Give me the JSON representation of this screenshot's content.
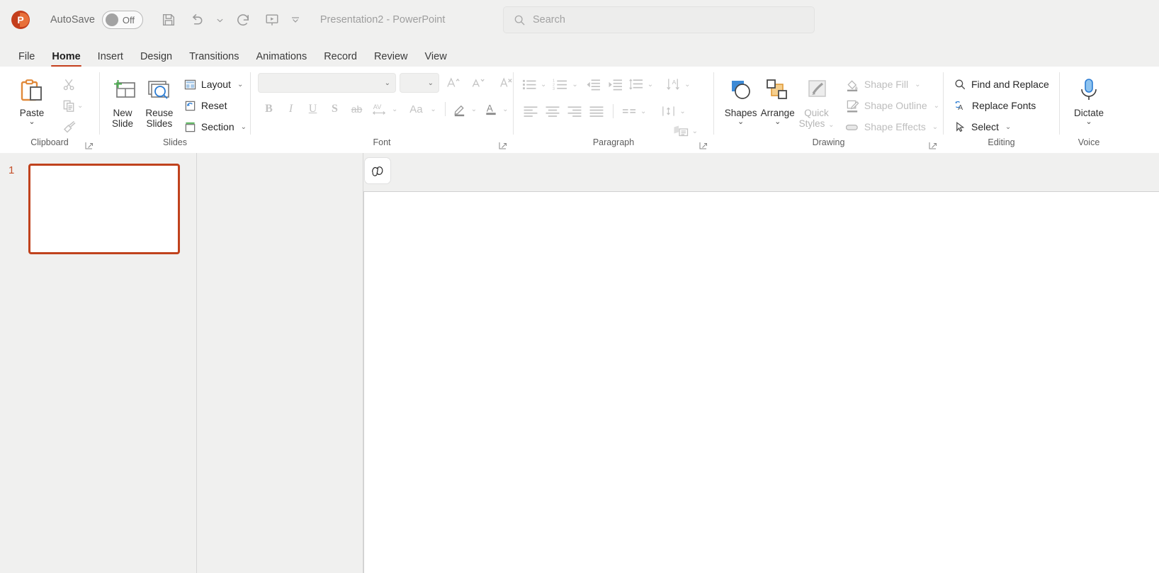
{
  "titlebar": {
    "logo_name": "powerpoint-logo",
    "logo_letter": "P",
    "autosave_label": "AutoSave",
    "autosave_state": "Off",
    "document_title": "Presentation2  -  PowerPoint",
    "quick_access": [
      {
        "name": "save-button",
        "icon": "save-icon"
      },
      {
        "name": "undo-button",
        "icon": "undo-icon"
      },
      {
        "name": "undo-dropdown",
        "icon": "chevron-down-icon"
      },
      {
        "name": "redo-button",
        "icon": "redo-icon"
      },
      {
        "name": "start-presentation-button",
        "icon": "presentation-icon"
      },
      {
        "name": "customize-quick-access-toolbar",
        "icon": "chevron-down-small-icon"
      }
    ]
  },
  "search": {
    "placeholder": "Search",
    "value": "",
    "icon": "search-icon"
  },
  "tabs": [
    {
      "label": "File",
      "active": false
    },
    {
      "label": "Home",
      "active": true
    },
    {
      "label": "Insert",
      "active": false
    },
    {
      "label": "Design",
      "active": false
    },
    {
      "label": "Transitions",
      "active": false
    },
    {
      "label": "Animations",
      "active": false
    },
    {
      "label": "Record",
      "active": false
    },
    {
      "label": "Review",
      "active": false
    },
    {
      "label": "View",
      "active": false
    }
  ],
  "ribbon": {
    "clipboard": {
      "group_label": "Clipboard",
      "paste_label": "Paste",
      "cut_label": "Cut",
      "copy_label": "Copy",
      "format_painter_label": "Format Painter",
      "dialog_launcher": "clipboard-dialog-launcher"
    },
    "slides": {
      "group_label": "Slides",
      "new_slide_label": "New Slide",
      "reuse_slides_label": "Reuse Slides",
      "layout_label": "Layout",
      "reset_label": "Reset",
      "section_label": "Section"
    },
    "font": {
      "group_label": "Font",
      "font_name_value": "",
      "font_size_value": "",
      "increase_font_size": "Increase Font Size",
      "decrease_font_size": "Decrease Font Size",
      "clear_formatting": "Clear All Formatting",
      "bold": "B",
      "italic": "I",
      "underline": "U",
      "shadow": "S",
      "strikethrough": "ab",
      "character_spacing": "AV",
      "change_case": "Aa",
      "text_highlight": "Text Highlight Color",
      "font_color": "Font Color",
      "dialog_launcher": "font-dialog-launcher"
    },
    "paragraph": {
      "group_label": "Paragraph",
      "bullets": "Bullets",
      "numbering": "Numbering",
      "decrease_indent": "Decrease List Level",
      "increase_indent": "Increase List Level",
      "line_spacing": "Line Spacing",
      "align_left": "Align Left",
      "center": "Center",
      "align_right": "Align Right",
      "justify": "Justify",
      "columns": "Columns",
      "text_direction": "Text Direction",
      "align_text": "Align Text",
      "smart_art": "Convert to SmartArt",
      "dialog_launcher": "paragraph-dialog-launcher"
    },
    "drawing": {
      "group_label": "Drawing",
      "shapes_label": "Shapes",
      "arrange_label": "Arrange",
      "quick_styles_label": "Quick Styles",
      "shape_fill_label": "Shape Fill",
      "shape_outline_label": "Shape Outline",
      "shape_effects_label": "Shape Effects",
      "dialog_launcher": "drawing-dialog-launcher"
    },
    "editing": {
      "group_label": "Editing",
      "find_replace_label": "Find and Replace",
      "replace_fonts_label": "Replace Fonts",
      "select_label": "Select"
    },
    "voice": {
      "group_label": "Voice",
      "dictate_label": "Dictate"
    }
  },
  "thumbnails": {
    "slides": [
      {
        "number": "1",
        "selected": true
      }
    ]
  },
  "canvas": {
    "copilot_label": "Copilot",
    "slide_content": ""
  },
  "colors": {
    "accent": "#c43e1c",
    "selection_border": "#c0421d",
    "ribbon_bg": "#ffffff",
    "chrome_bg": "#f0f0ef",
    "slide_bg": "#ffffff",
    "disabled_text": "#bdbdbd"
  }
}
